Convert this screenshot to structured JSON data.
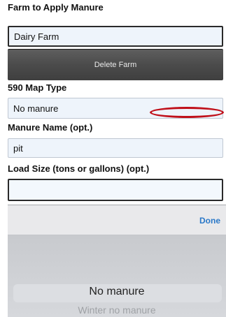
{
  "form": {
    "farm_label": "Farm to Apply Manure",
    "farm_value": "Dairy Farm",
    "delete_button": "Delete Farm",
    "map_type_label": "590 Map Type",
    "map_type_value": "No manure",
    "manure_name_label": "Manure Name (opt.)",
    "manure_name_value": "pit",
    "load_size_label": "Load Size (tons or gallons) (opt.)",
    "load_size_value": ""
  },
  "annotation": {
    "oval_color": "#c0101a"
  },
  "picker": {
    "done_label": "Done",
    "selected_option": "No manure",
    "next_option": "Winter no manure"
  },
  "colors": {
    "done_blue": "#2a78c8",
    "delete_button_bg": "#4b4b4b",
    "field_bg": "#eef4fb"
  }
}
